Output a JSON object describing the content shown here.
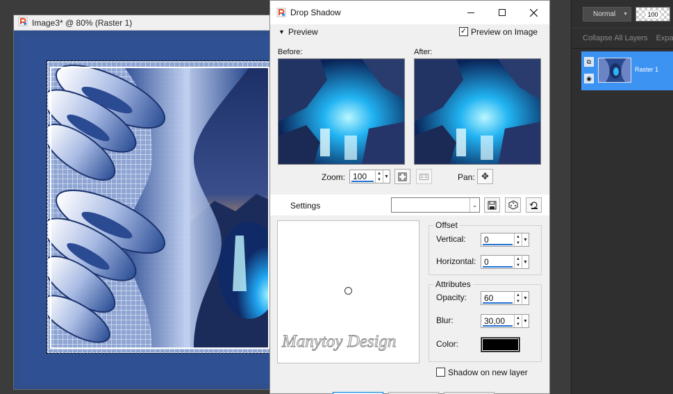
{
  "image_window": {
    "title": "Image3* @  80% (Raster 1)",
    "watermark": "Manytoy Design"
  },
  "dialog": {
    "title": "Drop Shadow",
    "preview_label": "Preview",
    "preview_on_image_label": "Preview on Image",
    "preview_on_image_checked": true,
    "before_label": "Before:",
    "after_label": "After:",
    "zoom_label": "Zoom:",
    "zoom_value": "100",
    "pan_label": "Pan:",
    "settings_label": "Settings",
    "settings_value": "",
    "offset": {
      "title": "Offset",
      "vertical_label": "Vertical:",
      "vertical_value": "0",
      "horizontal_label": "Horizontal:",
      "horizontal_value": "0"
    },
    "attributes": {
      "title": "Attributes",
      "opacity_label": "Opacity:",
      "opacity_value": "60",
      "blur_label": "Blur:",
      "blur_value": "30,00",
      "color_label": "Color:",
      "color_value": "#000000"
    },
    "shadow_new_layer_label": "Shadow on new layer",
    "shadow_new_layer_checked": false
  },
  "layers_panel": {
    "blend_mode": "Normal",
    "opacity": "100",
    "collapse_label": "Collapse All Layers",
    "expand_label": "Expa",
    "layer_name": "Raster 1",
    "accent_color": "#3c93f2"
  },
  "icons": {
    "app": "paintshop-app-icon",
    "minimize": "minimize-icon",
    "maximize": "maximize-icon",
    "close": "close-icon"
  }
}
